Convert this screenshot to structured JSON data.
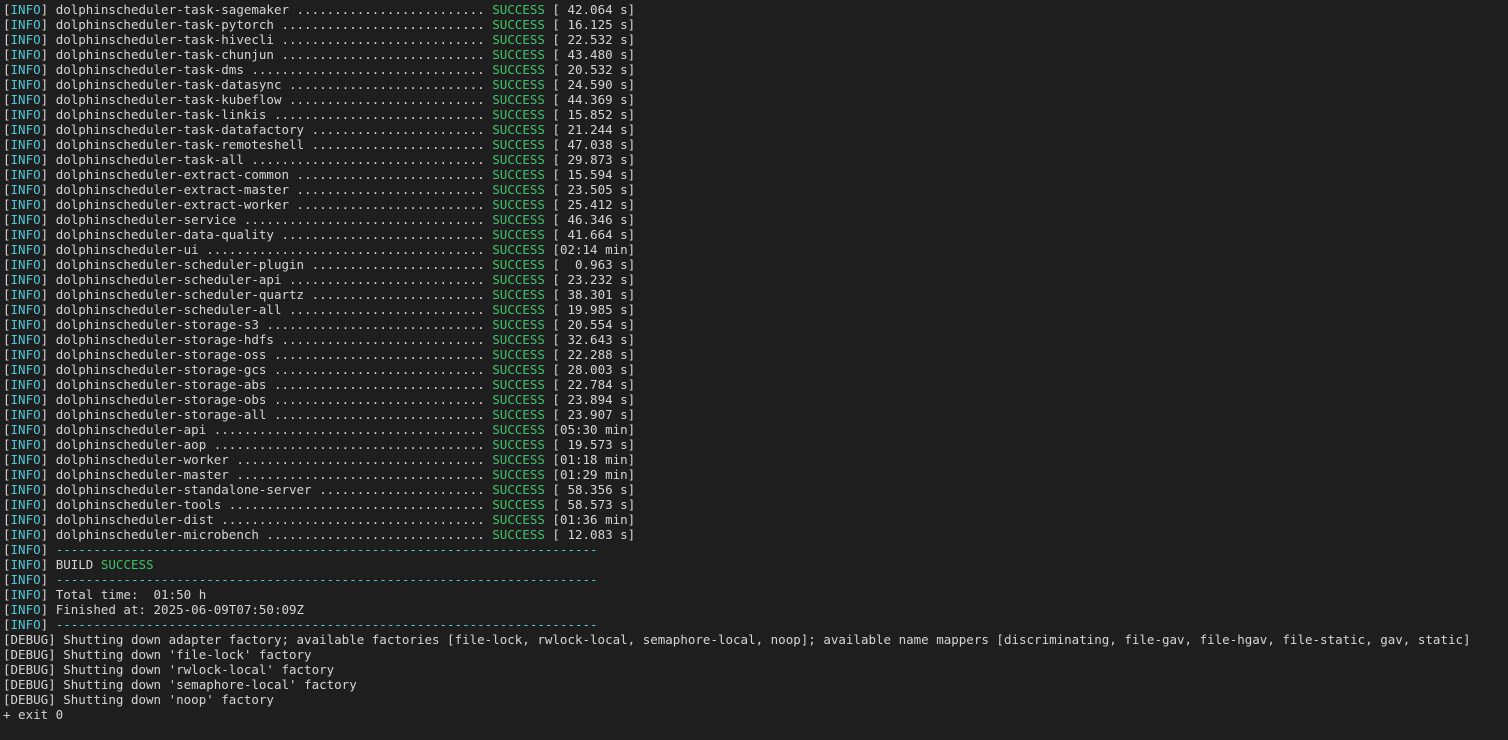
{
  "terminal": {
    "info_word": "INFO",
    "debug_word": "DEBUG",
    "success_word": "SUCCESS",
    "modules": [
      {
        "name": "dolphinscheduler-task-sagemaker",
        "time": "[ 42.064 s]"
      },
      {
        "name": "dolphinscheduler-task-pytorch",
        "time": "[ 16.125 s]"
      },
      {
        "name": "dolphinscheduler-task-hivecli",
        "time": "[ 22.532 s]"
      },
      {
        "name": "dolphinscheduler-task-chunjun",
        "time": "[ 43.480 s]"
      },
      {
        "name": "dolphinscheduler-task-dms",
        "time": "[ 20.532 s]"
      },
      {
        "name": "dolphinscheduler-task-datasync",
        "time": "[ 24.590 s]"
      },
      {
        "name": "dolphinscheduler-task-kubeflow",
        "time": "[ 44.369 s]"
      },
      {
        "name": "dolphinscheduler-task-linkis",
        "time": "[ 15.852 s]"
      },
      {
        "name": "dolphinscheduler-task-datafactory",
        "time": "[ 21.244 s]"
      },
      {
        "name": "dolphinscheduler-task-remoteshell",
        "time": "[ 47.038 s]"
      },
      {
        "name": "dolphinscheduler-task-all",
        "time": "[ 29.873 s]"
      },
      {
        "name": "dolphinscheduler-extract-common",
        "time": "[ 15.594 s]"
      },
      {
        "name": "dolphinscheduler-extract-master",
        "time": "[ 23.505 s]"
      },
      {
        "name": "dolphinscheduler-extract-worker",
        "time": "[ 25.412 s]"
      },
      {
        "name": "dolphinscheduler-service",
        "time": "[ 46.346 s]"
      },
      {
        "name": "dolphinscheduler-data-quality",
        "time": "[ 41.664 s]"
      },
      {
        "name": "dolphinscheduler-ui",
        "time": "[02:14 min]"
      },
      {
        "name": "dolphinscheduler-scheduler-plugin",
        "time": "[  0.963 s]"
      },
      {
        "name": "dolphinscheduler-scheduler-api",
        "time": "[ 23.232 s]"
      },
      {
        "name": "dolphinscheduler-scheduler-quartz",
        "time": "[ 38.301 s]"
      },
      {
        "name": "dolphinscheduler-scheduler-all",
        "time": "[ 19.985 s]"
      },
      {
        "name": "dolphinscheduler-storage-s3",
        "time": "[ 20.554 s]"
      },
      {
        "name": "dolphinscheduler-storage-hdfs",
        "time": "[ 32.643 s]"
      },
      {
        "name": "dolphinscheduler-storage-oss",
        "time": "[ 22.288 s]"
      },
      {
        "name": "dolphinscheduler-storage-gcs",
        "time": "[ 28.003 s]"
      },
      {
        "name": "dolphinscheduler-storage-abs",
        "time": "[ 22.784 s]"
      },
      {
        "name": "dolphinscheduler-storage-obs",
        "time": "[ 23.894 s]"
      },
      {
        "name": "dolphinscheduler-storage-all",
        "time": "[ 23.907 s]"
      },
      {
        "name": "dolphinscheduler-api",
        "time": "[05:30 min]"
      },
      {
        "name": "dolphinscheduler-aop",
        "time": "[ 19.573 s]"
      },
      {
        "name": "dolphinscheduler-worker",
        "time": "[01:18 min]"
      },
      {
        "name": "dolphinscheduler-master",
        "time": "[01:29 min]"
      },
      {
        "name": "dolphinscheduler-standalone-server",
        "time": "[ 58.356 s]"
      },
      {
        "name": "dolphinscheduler-tools",
        "time": "[ 58.573 s]"
      },
      {
        "name": "dolphinscheduler-dist",
        "time": "[01:36 min]"
      },
      {
        "name": "dolphinscheduler-microbench",
        "time": "[ 12.083 s]"
      }
    ],
    "separator": "------------------------------------------------------------------------",
    "build_label": "BUILD",
    "total_time": "Total time:  01:50 h",
    "finished_at": "Finished at: 2025-06-09T07:50:09Z",
    "debug_lines": [
      "Shutting down adapter factory; available factories [file-lock, rwlock-local, semaphore-local, noop]; available name mappers [discriminating, file-gav, file-hgav, file-static, gav, static]",
      "Shutting down 'file-lock' factory",
      "Shutting down 'rwlock-local' factory",
      "Shutting down 'semaphore-local' factory",
      "Shutting down 'noop' factory"
    ],
    "exit_line": "+ exit 0"
  },
  "colors": {
    "background": "#1e1e1e",
    "text": "#d4d4d4",
    "info": "#4ec9d8",
    "success": "#3fc26a"
  }
}
